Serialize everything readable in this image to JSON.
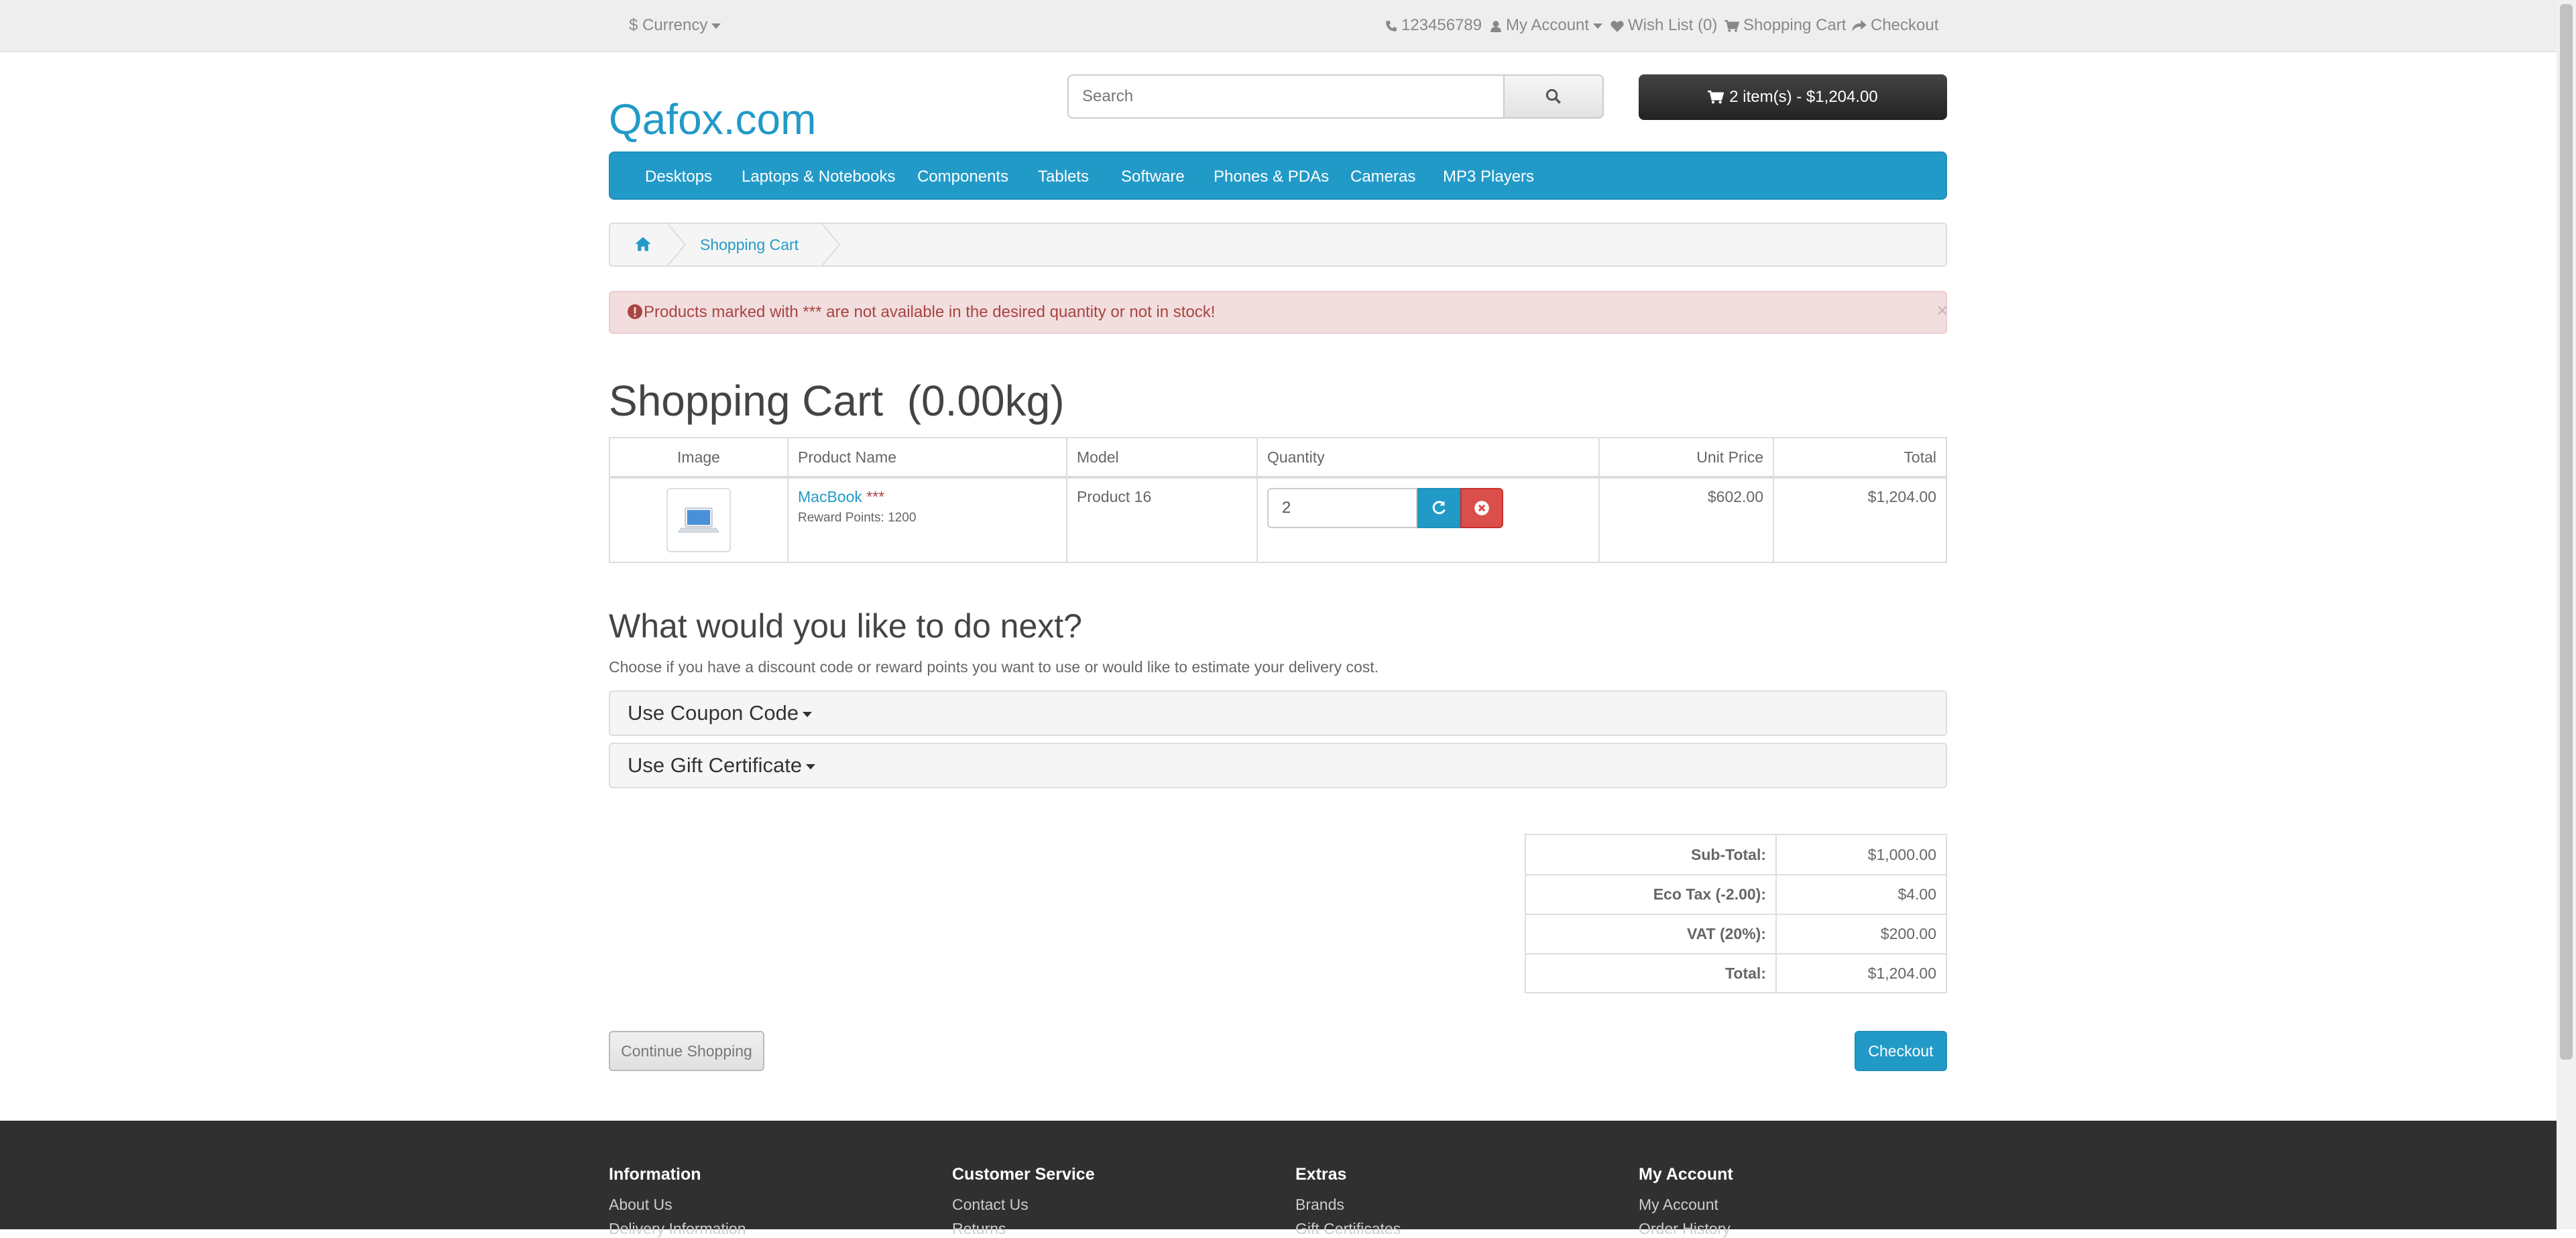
{
  "top_bar": {
    "currency": "$ Currency",
    "phone": "123456789",
    "my_account": "My Account",
    "wish_list": "Wish List (0)",
    "shopping_cart": "Shopping Cart",
    "checkout": "Checkout"
  },
  "header": {
    "logo": "Qafox.com",
    "search_placeholder": "Search",
    "cart_button": "2 item(s) - $1,204.00"
  },
  "menu": [
    "Desktops",
    "Laptops & Notebooks",
    "Components",
    "Tablets",
    "Software",
    "Phones & PDAs",
    "Cameras",
    "MP3 Players"
  ],
  "breadcrumb": {
    "home_icon": "home-icon",
    "current": "Shopping Cart"
  },
  "alert": {
    "text": "Products marked with *** are not available in the desired quantity or not in stock!",
    "close": "×"
  },
  "cart": {
    "title": "Shopping Cart  (0.00kg)",
    "columns": [
      "Image",
      "Product Name",
      "Model",
      "Quantity",
      "Unit Price",
      "Total"
    ],
    "items": [
      {
        "name": "MacBook",
        "stock_mark": "***",
        "reward": "Reward Points: 1200",
        "model": "Product 16",
        "quantity": "2",
        "unit_price": "$602.00",
        "total": "$1,204.00"
      }
    ]
  },
  "next": {
    "title": "What would you like to do next?",
    "description": "Choose if you have a discount code or reward points you want to use or would like to estimate your delivery cost.",
    "panels": [
      "Use Coupon Code",
      "Use Gift Certificate"
    ]
  },
  "totals": [
    {
      "label": "Sub-Total:",
      "value": "$1,000.00"
    },
    {
      "label": "Eco Tax (-2.00):",
      "value": "$4.00"
    },
    {
      "label": "VAT (20%):",
      "value": "$200.00"
    },
    {
      "label": "Total:",
      "value": "$1,204.00"
    }
  ],
  "buttons": {
    "continue": "Continue Shopping",
    "checkout": "Checkout"
  },
  "footer": {
    "columns": [
      {
        "heading": "Information",
        "links": [
          "About Us",
          "Delivery Information"
        ]
      },
      {
        "heading": "Customer Service",
        "links": [
          "Contact Us",
          "Returns"
        ]
      },
      {
        "heading": "Extras",
        "links": [
          "Brands",
          "Gift Certificates"
        ]
      },
      {
        "heading": "My Account",
        "links": [
          "My Account",
          "Order History"
        ]
      }
    ]
  },
  "colors": {
    "brand": "#229ac8",
    "alert_bg": "#f2dede",
    "alert_text": "#a94442",
    "remove": "#da4f49",
    "footer_bg": "#303030"
  }
}
